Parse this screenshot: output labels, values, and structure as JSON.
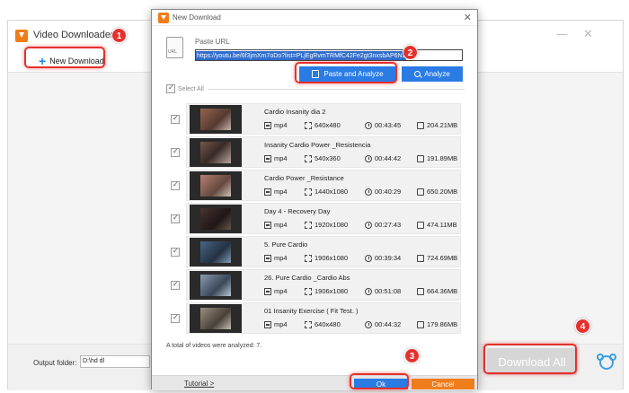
{
  "colors": {
    "accent": "#2a7be4",
    "brand": "#ef7c19",
    "highlight": "#e5312d",
    "cancel": "#f07d1c"
  },
  "main": {
    "title": "Video Downloader",
    "new_download_label": "New Download",
    "output_folder_label": "Output folder:",
    "output_folder_value": "D:\\hd dl",
    "download_all_label": "Download All",
    "window_controls": [
      "—",
      "✕"
    ]
  },
  "modal": {
    "title": "New Download",
    "close": "✕",
    "paste_url_label": "Paste URL",
    "url_value": "https://youtu.be/6f3jmXm7oDo?list=PLjEgRvmTRMfC42Fe2gt3nxsbAP6NJ",
    "paste_analyze_label": "Paste and Analyze",
    "analyze_label": "Analyze",
    "select_all_label": "Select All",
    "total_text": "A total of videos were analyzed: 7.",
    "tutorial_label": "Tutorial >",
    "ok_label": "Ok",
    "cancel_label": "Cancel"
  },
  "videos": [
    {
      "title": "Cardio Insanity dia 2",
      "format": "mp4",
      "resolution": "640x480",
      "duration": "00:43:45",
      "size": "204.21MB"
    },
    {
      "title": "Insanity Cardio Power _Resistencia",
      "format": "mp4",
      "resolution": "540x360",
      "duration": "00:44:42",
      "size": "191.89MB"
    },
    {
      "title": "Cardio Power _Resistance",
      "format": "mp4",
      "resolution": "1440x1080",
      "duration": "00:40:29",
      "size": "650.20MB"
    },
    {
      "title": "Day 4 - Recovery Day",
      "format": "mp4",
      "resolution": "1920x1080",
      "duration": "00:27:43",
      "size": "474.11MB"
    },
    {
      "title": "5. Pure Cardio",
      "format": "mp4",
      "resolution": "1906x1080",
      "duration": "00:39:34",
      "size": "724.69MB"
    },
    {
      "title": "26. Pure Cardio _Cardio Abs",
      "format": "mp4",
      "resolution": "1906x1080",
      "duration": "00:51:08",
      "size": "664.36MB"
    },
    {
      "title": "01 Insanity Exercise ( Fit Test. )",
      "format": "mp4",
      "resolution": "640x480",
      "duration": "00:44:32",
      "size": "179.86MB"
    }
  ],
  "badges": [
    "1",
    "2",
    "3",
    "4"
  ]
}
